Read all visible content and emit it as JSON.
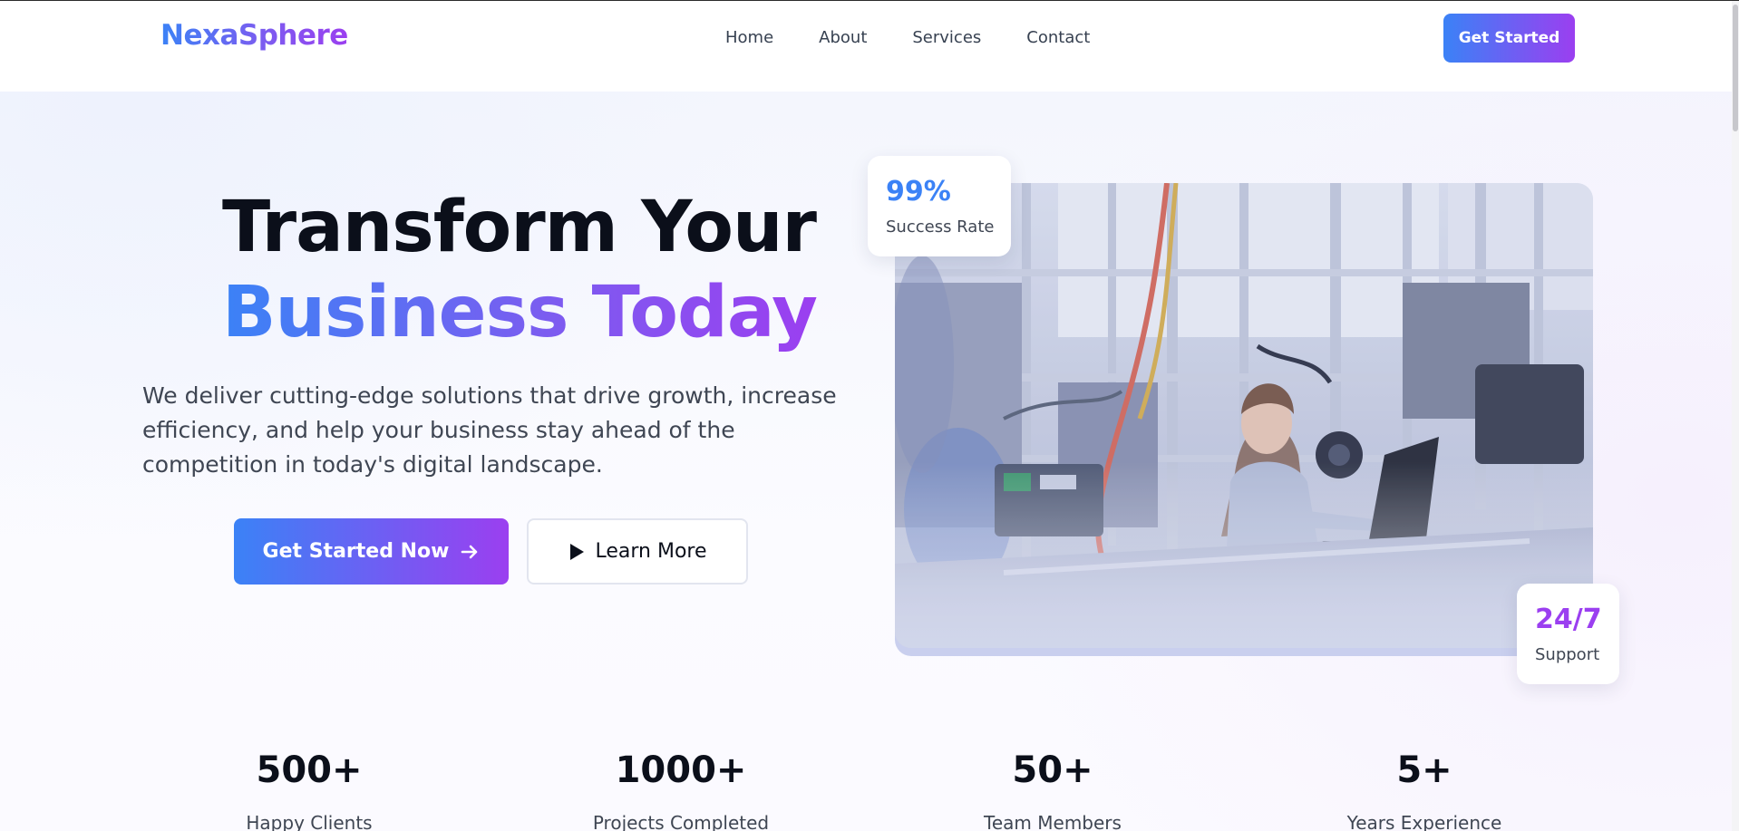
{
  "nav": {
    "logo": "NexaSphere",
    "links": [
      "Home",
      "About",
      "Services",
      "Contact"
    ],
    "cta": "Get Started"
  },
  "hero": {
    "headline_line1": "Transform Your",
    "headline_line2": "Business Today",
    "description": "We deliver cutting-edge solutions that drive growth, increase efficiency, and help your business stay ahead of the competition in today's digital landscape.",
    "primary_button": "Get Started Now",
    "secondary_button": "Learn More"
  },
  "badges": {
    "top": {
      "value": "99%",
      "label": "Success Rate"
    },
    "bottom": {
      "value": "24/7",
      "label": "Support"
    }
  },
  "stats": [
    {
      "value": "500+",
      "label": "Happy Clients"
    },
    {
      "value": "1000+",
      "label": "Projects Completed"
    },
    {
      "value": "50+",
      "label": "Team Members"
    },
    {
      "value": "5+",
      "label": "Years Experience"
    }
  ],
  "colors": {
    "brand_blue": "#3b82f6",
    "brand_purple": "#9b3ff0",
    "text_dark": "#0b0f1a",
    "text_muted": "#3f4653"
  },
  "icons": {
    "primary_button": "arrow-right-icon",
    "secondary_button": "play-icon"
  }
}
